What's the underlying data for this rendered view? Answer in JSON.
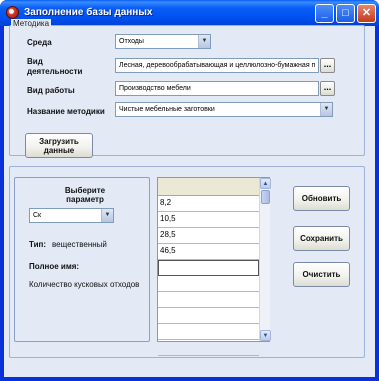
{
  "window": {
    "title": "Заполнение базы данных",
    "controls": {
      "minimize": "_",
      "maximize": "□",
      "close": "✕"
    }
  },
  "method_group": {
    "legend": "Методика",
    "environment": {
      "label": "Среда",
      "value": "Отходы"
    },
    "activity": {
      "label_line1": "Вид",
      "label_line2": "деятельности",
      "value": "Лесная, деревообрабатывающая и целлюлозно-бумажная п"
    },
    "work": {
      "label": "Вид работы",
      "value": "Производство мебели"
    },
    "method_name": {
      "label": "Название методики",
      "value": "Чистые мебельные заготовки"
    },
    "browse_label": "..."
  },
  "load_button": {
    "line1": "Загрузить",
    "line2": "данные"
  },
  "param_panel": {
    "heading_line1": "Выберите",
    "heading_line2": "параметр",
    "param_value": "Ск",
    "type_label": "Тип:",
    "type_value": "вещественный",
    "fullname_label": "Полное имя:",
    "fullname_value": "Количество кусковых отходов"
  },
  "grid": {
    "rows": [
      "8,2",
      "10,5",
      "28,5",
      "46,5",
      "",
      "",
      "",
      "",
      "",
      ""
    ]
  },
  "actions": {
    "refresh": "Обновить",
    "save": "Сохранить",
    "clear": "Очистить"
  },
  "icons": {
    "dropdown": "▼",
    "scroll_up": "▲",
    "scroll_down": "▼"
  },
  "colors": {
    "titlebar": "#0a5ef6",
    "client_bg": "#e3eaf6",
    "group_border": "#9db2d6"
  }
}
